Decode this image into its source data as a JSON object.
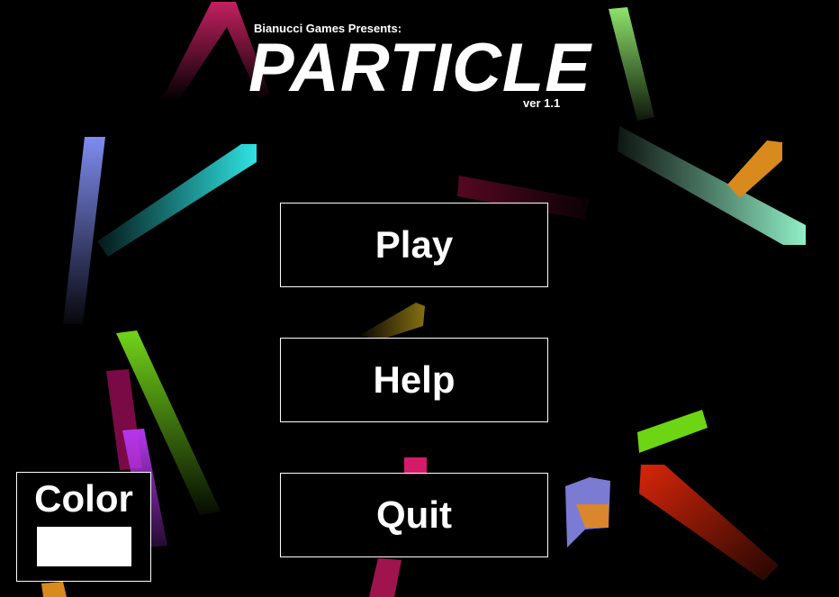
{
  "header": {
    "presents": "Bianucci Games Presents:",
    "title": "PARTICLE",
    "version": "ver 1.1"
  },
  "menu": {
    "play_label": "Play",
    "help_label": "Help",
    "quit_label": "Quit"
  },
  "color_picker": {
    "label": "Color",
    "selected_color": "#ffffff"
  },
  "particle_colors": [
    "#d9246b",
    "#8ee36b",
    "#7f8cf0",
    "#2fe3e3",
    "#8dd9b4",
    "#d88a1c",
    "#6a0a2a",
    "#c0a01a",
    "#72d41a",
    "#a2145e",
    "#b637ef",
    "#d31b6a",
    "#6cd514",
    "#d7260a",
    "#9090f8",
    "#d9862c"
  ]
}
